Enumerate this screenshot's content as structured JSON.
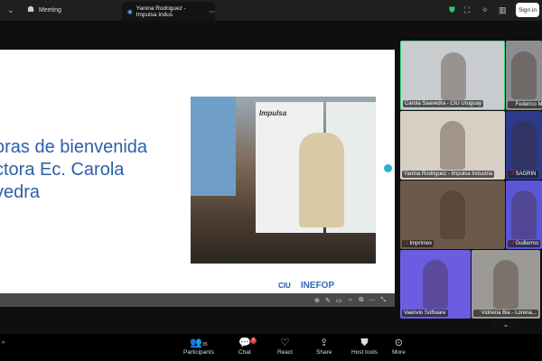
{
  "topbar": {
    "menu_label": "Meeting",
    "tab_title": "Yanina Rodriguez - Impulsa Indus",
    "sign_in": "Sign in"
  },
  "slide": {
    "heading": "oras de bienvenida\nctora Ec. Carola\nvedra",
    "photo_banner": "Impulsa",
    "logo_ciu": "CIU",
    "logo_inefop": "INEFOP"
  },
  "gallery": [
    {
      "name": "Carola Saavedra - CIU Uruguay",
      "muted": false,
      "active": true,
      "bg": "#c9ccce"
    },
    {
      "name": "Federico M",
      "muted": true,
      "bg": "#8b8d90"
    },
    {
      "name": "Yanina Rodriguez - Impulsa Industria",
      "muted": false,
      "bg": "#d8cfc4"
    },
    {
      "name": "SAGRIN",
      "muted": true,
      "bg": "#2b3a8a"
    },
    {
      "name": "Imprimex",
      "muted": true,
      "bg": "#6b5a4a"
    },
    {
      "name": "Guillermo",
      "muted": true,
      "bg": "#5d55d8"
    },
    {
      "name": "Vaenvio Software",
      "muted": false,
      "bg": "#6c5ce0"
    },
    {
      "name": "Vidrieria Bia - Lorena...",
      "muted": true,
      "bg": "#9c9a96"
    }
  ],
  "toolbar": {
    "participants_label": "Participants",
    "participants_count": "35",
    "chat_label": "Chat",
    "chat_badge": "2",
    "react_label": "React",
    "share_label": "Share",
    "host_tools_label": "Host tools",
    "more_label": "More"
  },
  "colors": {
    "active_speaker": "#3ddc84",
    "slide_text": "#2d5ea8",
    "badge": "#e3342f"
  }
}
